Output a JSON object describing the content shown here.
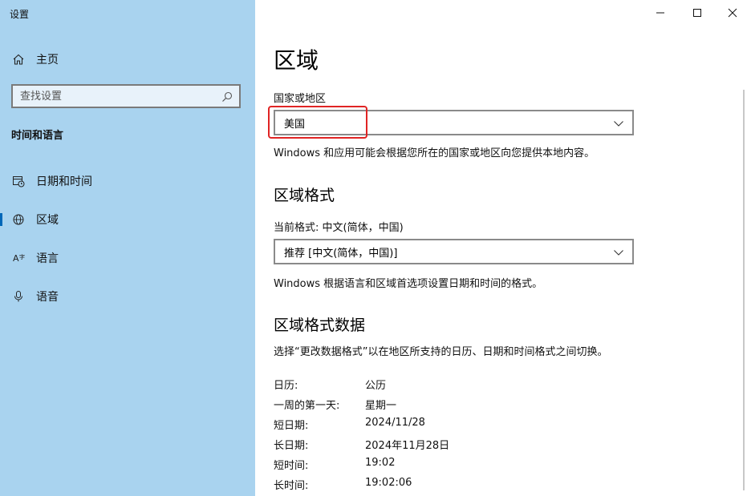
{
  "window": {
    "title": "设置"
  },
  "sidebar": {
    "home_label": "主页",
    "search_placeholder": "查找设置",
    "section_heading": "时间和语言",
    "items": [
      {
        "label": "日期和时间",
        "icon": "calendar-clock-icon"
      },
      {
        "label": "区域",
        "icon": "globe-icon",
        "active": true
      },
      {
        "label": "语言",
        "icon": "language-icon"
      },
      {
        "label": "语音",
        "icon": "microphone-icon"
      }
    ]
  },
  "main": {
    "title": "区域",
    "country": {
      "label": "国家或地区",
      "value": "美国",
      "description": "Windows 和应用可能会根据您所在的国家或地区向您提供本地内容。"
    },
    "format": {
      "heading": "区域格式",
      "label": "当前格式: 中文(简体，中国)",
      "value": "推荐 [中文(简体，中国)]",
      "description": "Windows 根据语言和区域首选项设置日期和时间的格式。"
    },
    "format_data": {
      "heading": "区域格式数据",
      "description": "选择“更改数据格式”以在地区所支持的日历、日期和时间格式之间切换。",
      "rows": [
        {
          "label": "日历:",
          "value": "公历"
        },
        {
          "label": "一周的第一天:",
          "value": "星期一"
        },
        {
          "label": "短日期:",
          "value": "2024/11/28"
        },
        {
          "label": "长日期:",
          "value": "2024年11月28日"
        },
        {
          "label": "短时间:",
          "value": "19:02"
        },
        {
          "label": "长时间:",
          "value": "19:02:06"
        }
      ]
    }
  },
  "colors": {
    "sidebar_bg": "#a9d3ef",
    "accent": "#0067b8",
    "highlight": "#e02424"
  }
}
